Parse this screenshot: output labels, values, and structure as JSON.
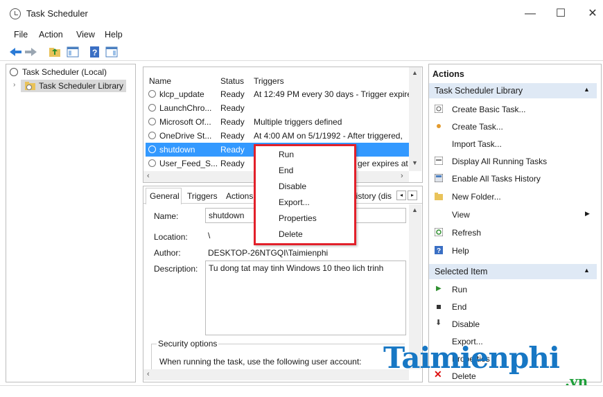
{
  "window": {
    "title": "Task Scheduler",
    "minimize": "—",
    "maximize": "☐",
    "close": "✕"
  },
  "menubar": [
    "File",
    "Action",
    "View",
    "Help"
  ],
  "tree": {
    "root": "Task Scheduler (Local)",
    "child": "Task Scheduler Library"
  },
  "tasklist": {
    "columns": {
      "name": "Name",
      "status": "Status",
      "triggers": "Triggers"
    },
    "rows": [
      {
        "name": "klcp_update",
        "status": "Ready",
        "triggers": "At 12:49 PM every 30 days - Trigger expire"
      },
      {
        "name": "LaunchChro...",
        "status": "Ready",
        "triggers": ""
      },
      {
        "name": "Microsoft Of...",
        "status": "Ready",
        "triggers": "Multiple triggers defined"
      },
      {
        "name": "OneDrive St...",
        "status": "Ready",
        "triggers": "At 4:00 AM on 5/1/1992 - After triggered,"
      },
      {
        "name": "shutdown",
        "status": "Ready",
        "triggers": ""
      },
      {
        "name": "User_Feed_S...",
        "status": "Ready",
        "triggers": "ger expires at"
      }
    ]
  },
  "detail": {
    "tabs": [
      "General",
      "Triggers",
      "Actions",
      "History (dis"
    ],
    "name_label": "Name:",
    "name_value": "shutdown",
    "location_label": "Location:",
    "location_value": "\\",
    "author_label": "Author:",
    "author_value": "DESKTOP-26NTGQI\\Taimienphi",
    "description_label": "Description:",
    "description_value": "Tu dong tat may tinh Windows 10 theo lich trinh",
    "security_label": "Security options",
    "security_text": "When running the task, use the following user account:"
  },
  "context_menu": [
    "Run",
    "End",
    "Disable",
    "Export...",
    "Properties",
    "Delete"
  ],
  "actions": {
    "header": "Actions",
    "section1": "Task Scheduler Library",
    "items1": [
      "Create Basic Task...",
      "Create Task...",
      "Import Task...",
      "Display All Running Tasks",
      "Enable All Tasks History",
      "New Folder...",
      "View",
      "Refresh",
      "Help"
    ],
    "section2": "Selected Item",
    "items2": [
      "Run",
      "End",
      "Disable",
      "Export...",
      "Properties",
      "Delete"
    ]
  },
  "watermark": {
    "main": "Taimienphi",
    "sub": ".vn"
  },
  "colors": {
    "selection": "#3399ff",
    "context_border": "#e2202a",
    "action_header": "#dfe9f5",
    "watermark": "#1777c4"
  }
}
